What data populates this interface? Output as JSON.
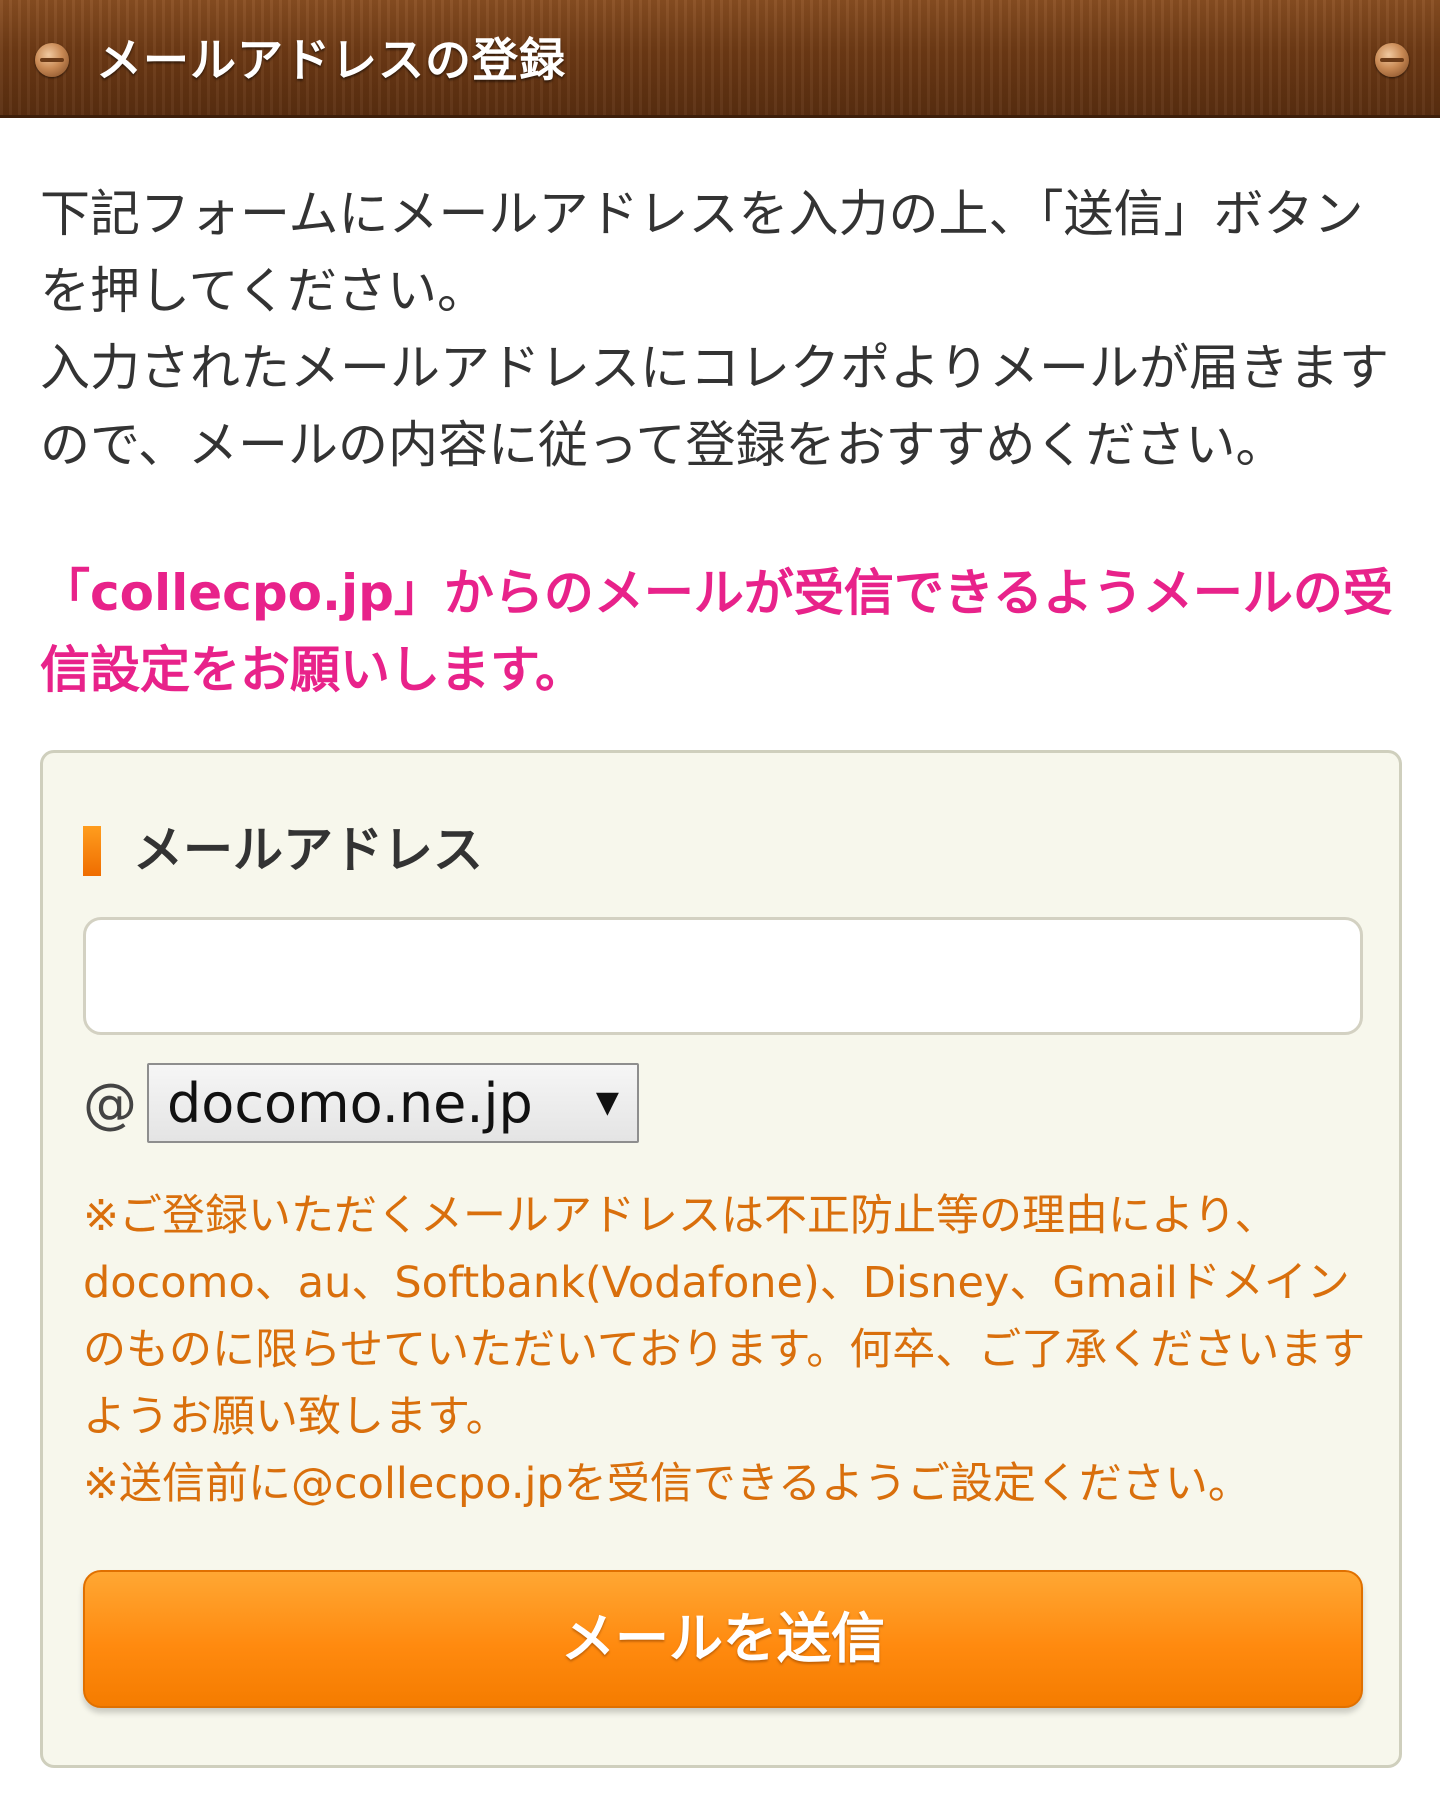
{
  "header": {
    "title": "メールアドレスの登録"
  },
  "intro": {
    "text": "下記フォームにメールアドレスを入力の上、「送信」ボタンを押してください。\n入力されたメールアドレスにコレクポよりメールが届きますので、メールの内容に従って登録をおすすめください。",
    "notice": "「collecpo.jp」からのメールが受信できるようメールの受信設定をお願いします。"
  },
  "form": {
    "email_label": "メールアドレス",
    "email_value": "",
    "at_sign": "@",
    "domain_selected": "docomo.ne.jp",
    "dropdown_arrow": "▼",
    "disclaimer": "※ご登録いただくメールアドレスは不正防止等の理由により、docomo、au、Softbank(Vodafone)、Disney、Gmailドメインのものに限らせていただいております。何卒、ご了承くださいますようお願い致します。\n※送信前に@collecpo.jpを受信できるようご設定ください。",
    "submit_label": "メールを送信"
  },
  "colors": {
    "header_brown": "#6e3a15",
    "notice_pink": "#e8228a",
    "disclaimer_orange": "#d96f0c",
    "button_orange": "#ff8a0f",
    "panel_bg": "#f7f7ec"
  }
}
